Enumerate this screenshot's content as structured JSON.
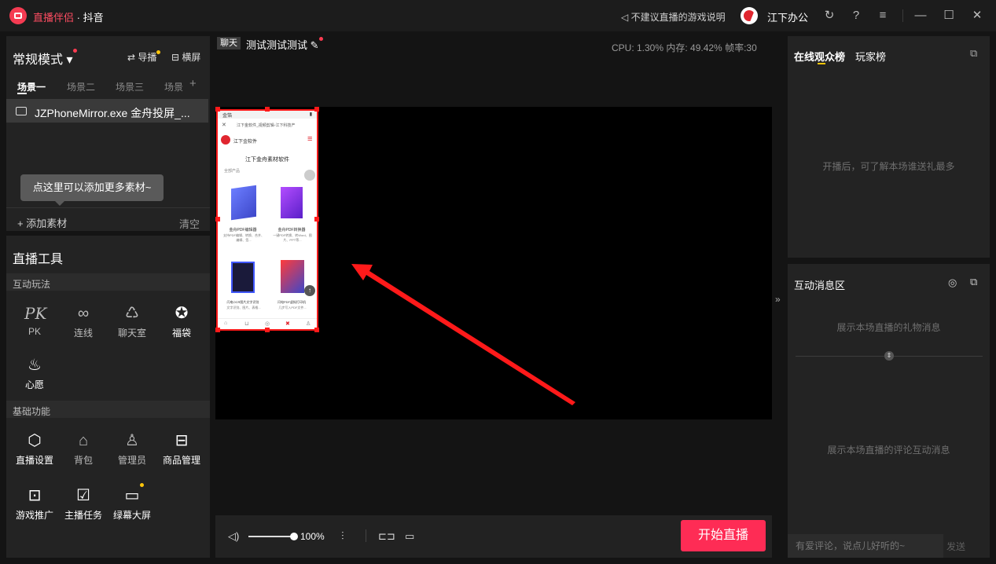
{
  "titlebar": {
    "app_name": "直播伴侣",
    "platform": "· 抖音",
    "game_notice": "不建议直播的游戏说明",
    "username": "江下办公"
  },
  "left": {
    "mode_title": "常规模式",
    "guide_btn": "导播",
    "landscape_btn": "横屏",
    "scene_tabs": [
      "场景一",
      "场景二",
      "场景三",
      "场景"
    ],
    "source_item": "JZPhoneMirror.exe 金舟投屏_...",
    "tooltip": "点这里可以添加更多素材~",
    "add_source": "+ 添加素材",
    "clear": "清空"
  },
  "tools": {
    "title": "直播工具",
    "section_interactive": "互动玩法",
    "interactive": [
      {
        "label": "PK",
        "icon": "pk-icon"
      },
      {
        "label": "连线",
        "icon": "link-icon"
      },
      {
        "label": "聊天室",
        "icon": "chatroom-icon"
      },
      {
        "label": "福袋",
        "icon": "lucky-bag-icon"
      },
      {
        "label": "心愿",
        "icon": "wish-lamp-icon"
      }
    ],
    "section_basic": "基础功能",
    "basic": [
      {
        "label": "直播设置",
        "icon": "settings-hex-icon"
      },
      {
        "label": "背包",
        "icon": "backpack-icon"
      },
      {
        "label": "管理员",
        "icon": "admin-icon"
      },
      {
        "label": "商品管理",
        "icon": "shop-icon"
      },
      {
        "label": "游戏推广",
        "icon": "gamepad-icon"
      },
      {
        "label": "主播任务",
        "icon": "task-icon"
      },
      {
        "label": "绿幕大屏",
        "icon": "screen-icon"
      }
    ]
  },
  "center": {
    "chat_badge": "聊天",
    "room_title": "测试测试测试",
    "stats": "CPU: 1.30%   内存: 49.42%   帧率:30",
    "volume": "100%",
    "start_button": "开始直播"
  },
  "phone": {
    "status_left": "金箔",
    "tab_title": "江下金软件_视频剪辑-江下科技产",
    "brand": "江下金软件",
    "headline": "江下金舟素材软件",
    "section": "全部产品",
    "products": [
      {
        "name": "金舟PDF编辑器",
        "desc": "支持PDF编辑、转换、合并、编辑、签..."
      },
      {
        "name": "金舟PDF转换器",
        "desc": "一键PDF转换、转Word、图片、PPT等..."
      },
      {
        "name": "闪电OCR图片文字识别",
        "desc": "文字识别、图片、表格..."
      },
      {
        "name": "闪电PDF虚拟打印机",
        "desc": "几步写入PDF文件..."
      }
    ]
  },
  "right": {
    "tab_audience": "在线观众榜",
    "tab_players": "玩家榜",
    "audience_hint": "开播后，可了解本场谁送礼最多",
    "interact_title": "互动消息区",
    "gift_hint": "展示本场直播的礼物消息",
    "comment_hint": "展示本场直播的评论互动消息",
    "comment_placeholder": "有爱评论，说点儿好听的~",
    "send": "发送"
  },
  "colors": {
    "accent": "#fe2c55",
    "selection": "#ff1a1a",
    "badge_dot": "#ffc60a"
  }
}
